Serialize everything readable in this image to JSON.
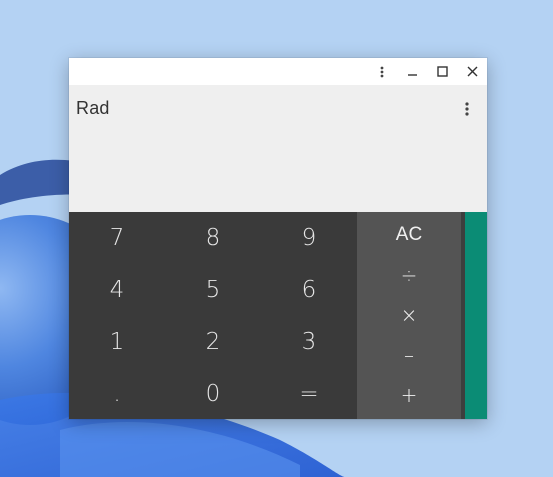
{
  "window": {
    "controls": {
      "menu_icon": "more-vert-icon",
      "minimize_icon": "minimize-icon",
      "maximize_icon": "maximize-icon",
      "close_icon": "close-icon"
    }
  },
  "display": {
    "mode": "Rad",
    "result": "",
    "menu_icon": "more-vert-icon"
  },
  "keypad": {
    "digits": [
      "7",
      "8",
      "9",
      "4",
      "5",
      "6",
      "1",
      "2",
      "3",
      ".",
      "0",
      "="
    ],
    "operators": [
      "AC",
      "÷",
      "×",
      "–",
      "+"
    ]
  },
  "colors": {
    "digit_pad": "#3a3a3a",
    "operator_pad": "#545454",
    "advanced_panel": "#0b8c75",
    "display_bg": "#efefef",
    "wallpaper": "#b4d2f3"
  }
}
